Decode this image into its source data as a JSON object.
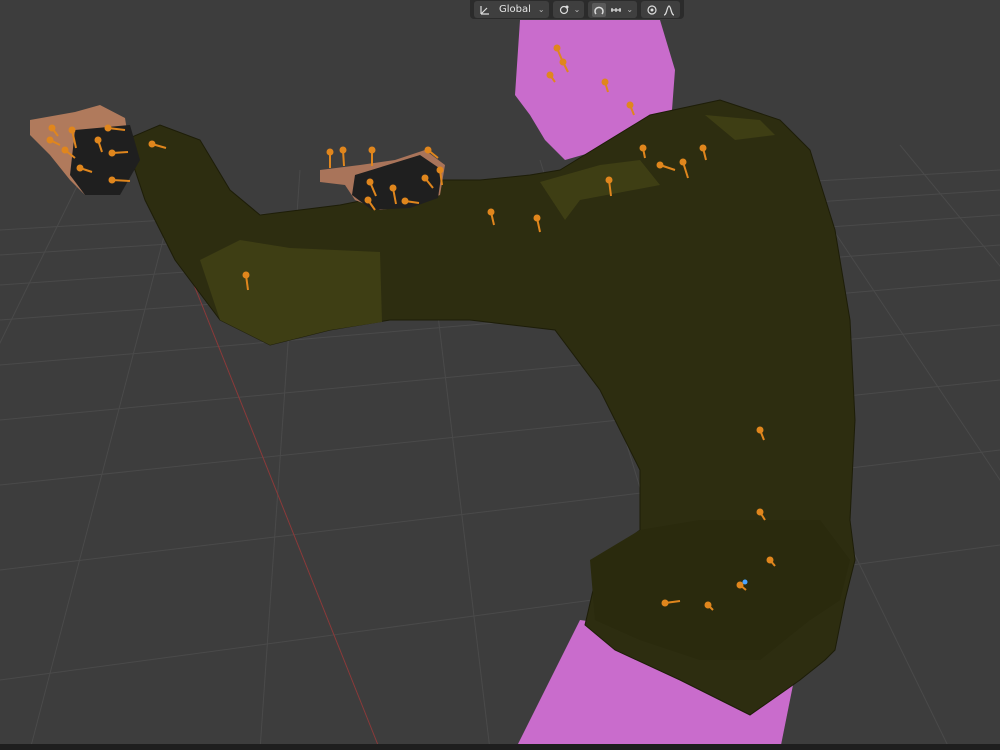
{
  "app": {
    "accent": "#e0861d",
    "viewport_bg": "#3d3d3d",
    "missing_texture_color": "#c96ccc",
    "sweater_color": "#2e2e0f"
  },
  "toolbar": {
    "orientation_icon": "transform-orientation-icon",
    "orientation_label": "Global",
    "pivot_icon": "pivot-point-icon",
    "snap_icon": "snap-icon",
    "snap_increment_icon": "snap-increment-icon",
    "proportional_icon": "proportional-editing-icon",
    "falloff_icon": "falloff-curve-icon"
  }
}
